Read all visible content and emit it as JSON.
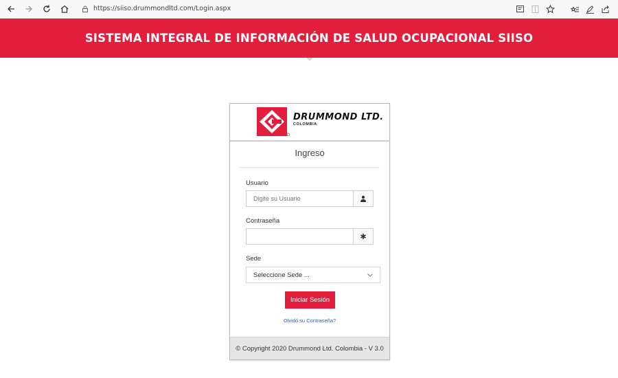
{
  "browser": {
    "url": "https://siiso.drummondltd.com/Login.aspx"
  },
  "header": {
    "title": "SISTEMA INTEGRAL DE INFORMACIÓN DE SALUD OCUPACIONAL SIISO"
  },
  "logo": {
    "name": "DRUMMOND LTD.",
    "subtitle": "COLOMBIA"
  },
  "login": {
    "title": "Ingreso",
    "username_label": "Usuario",
    "username_placeholder": "Digite su Usuario",
    "username_value": "",
    "password_label": "Contraseña",
    "password_value": "",
    "site_label": "Sede",
    "site_selected": "Seleccione Sede ...",
    "submit_label": "Iniciar Sesión",
    "forgot_label": "Olvidó su Contraseña?"
  },
  "footer": {
    "copyright": "© Copyright 2020 Drummond Ltd. Colombia - V 3.0"
  },
  "colors": {
    "brand_red": "#e31e3c",
    "link_blue": "#2b5fb3"
  },
  "icons": [
    "back-icon",
    "forward-icon",
    "refresh-icon",
    "home-icon",
    "lock-icon",
    "reading-view-icon",
    "split-view-icon",
    "favorite-star-icon",
    "favorites-list-icon",
    "pen-icon",
    "share-icon",
    "user-icon",
    "asterisk-icon",
    "chevron-down-icon"
  ]
}
